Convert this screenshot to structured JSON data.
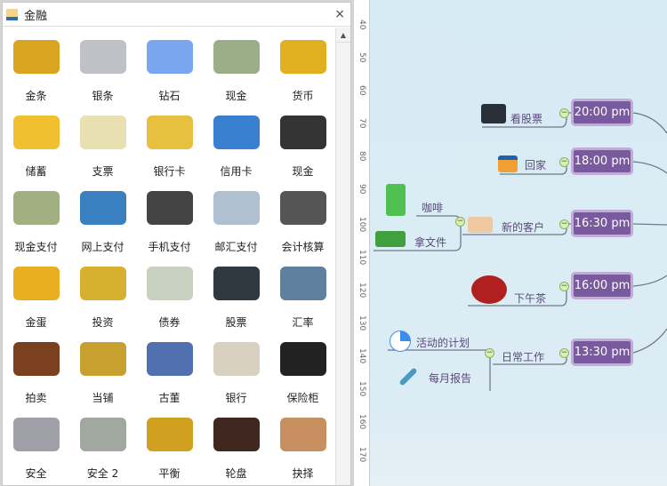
{
  "panel": {
    "title": "金融",
    "close": "×",
    "scroll_up": "▲",
    "items": [
      {
        "label": "金条",
        "color": "#d9a520"
      },
      {
        "label": "银条",
        "color": "#c0c0c8"
      },
      {
        "label": "钻石",
        "color": "#7aa6f0"
      },
      {
        "label": "现金",
        "color": "#9aae88"
      },
      {
        "label": "货币",
        "color": "#e0b020"
      },
      {
        "label": "储蓄",
        "color": "#f0c030"
      },
      {
        "label": "支票",
        "color": "#e8e0b0"
      },
      {
        "label": "银行卡",
        "color": "#e8c040"
      },
      {
        "label": "信用卡",
        "color": "#3a80d0"
      },
      {
        "label": "现金",
        "color": "#333333"
      },
      {
        "label": "现金支付",
        "color": "#a0b080"
      },
      {
        "label": "网上支付",
        "color": "#3a80c0"
      },
      {
        "label": "手机支付",
        "color": "#444444"
      },
      {
        "label": "邮汇支付",
        "color": "#b0c0d0"
      },
      {
        "label": "会计核算",
        "color": "#555555"
      },
      {
        "label": "金蛋",
        "color": "#e8b020"
      },
      {
        "label": "投资",
        "color": "#d8b030"
      },
      {
        "label": "债券",
        "color": "#c8d0c0"
      },
      {
        "label": "股票",
        "color": "#303840"
      },
      {
        "label": "汇率",
        "color": "#6080a0"
      },
      {
        "label": "拍卖",
        "color": "#7a4020"
      },
      {
        "label": "当铺",
        "color": "#c8a030"
      },
      {
        "label": "古董",
        "color": "#5070b0"
      },
      {
        "label": "银行",
        "color": "#d8d0c0"
      },
      {
        "label": "保险柜",
        "color": "#222222"
      },
      {
        "label": "安全",
        "color": "#a0a0a8"
      },
      {
        "label": "安全 2",
        "color": "#a0a8a0"
      },
      {
        "label": "平衡",
        "color": "#d0a020"
      },
      {
        "label": "轮盘",
        "color": "#402820"
      },
      {
        "label": "抉择",
        "color": "#c89060"
      }
    ]
  },
  "ruler": [
    "40",
    "50",
    "60",
    "70",
    "80",
    "90",
    "100",
    "110",
    "120",
    "130",
    "140",
    "150",
    "160",
    "170"
  ],
  "mindmap": {
    "times": [
      "20:00 pm",
      "18:00 pm",
      "16:30 pm",
      "16:00 pm",
      "13:30 pm"
    ],
    "topics": {
      "stocks": "看股票",
      "home": "回家",
      "client": "新的客户",
      "coffee": "咖啡",
      "files": "拿文件",
      "tea": "下午茶",
      "daily": "日常工作",
      "plan": "活动的计划",
      "report": "每月报告"
    }
  }
}
